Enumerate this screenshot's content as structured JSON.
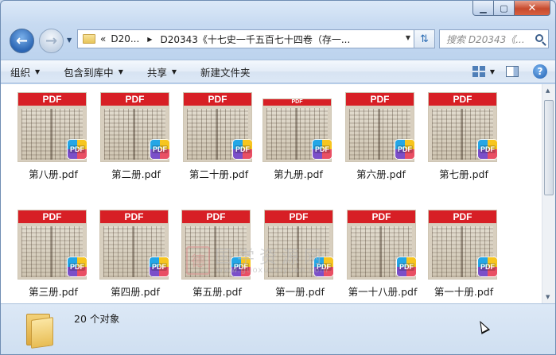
{
  "window": {
    "min_label": "▁",
    "max_label": "▢",
    "close_label": "✕"
  },
  "address": {
    "overflow": "«",
    "crumb1": "D20...",
    "crumb2": "D20343《十七史一千五百七十四卷（存一...",
    "search_placeholder": "搜索 D20343《..."
  },
  "toolbar": {
    "organize": "组织",
    "include_in_library": "包含到库中",
    "share": "共享",
    "new_folder": "新建文件夹"
  },
  "files": [
    {
      "name": "第八册.pdf"
    },
    {
      "name": "第二册.pdf"
    },
    {
      "name": "第二十册.pdf"
    },
    {
      "name": "第九册.pdf"
    },
    {
      "name": "第六册.pdf"
    },
    {
      "name": "第七册.pdf"
    },
    {
      "name": "第三册.pdf"
    },
    {
      "name": "第四册.pdf"
    },
    {
      "name": "第五册.pdf"
    },
    {
      "name": "第一册.pdf"
    },
    {
      "name": "第一十八册.pdf"
    },
    {
      "name": "第一十册.pdf"
    }
  ],
  "thumb_band": "PDF",
  "badge_text": "PDF",
  "watermark": {
    "seal": "德",
    "title": "国学资源网",
    "url": "www.guoxueziyuan.com"
  },
  "status": {
    "count_text": "20 个对象"
  },
  "colors": {
    "pdf_red": "#d71f25",
    "window_frame": "#bcd3ee",
    "close_red": "#c74a2e"
  }
}
